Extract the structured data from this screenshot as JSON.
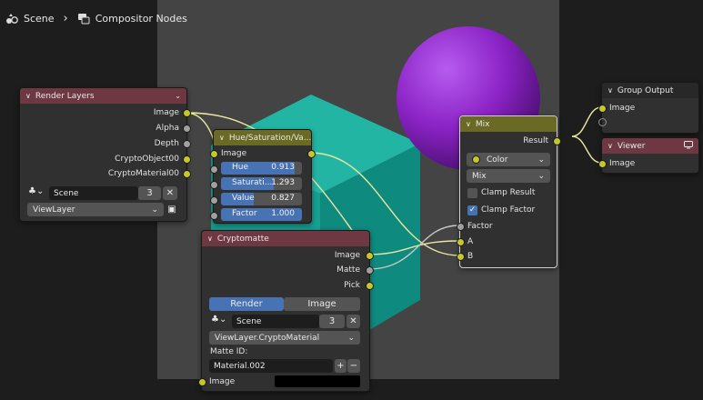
{
  "breadcrumb": {
    "scene": "Scene",
    "separator": "›",
    "tree": "Compositor Nodes",
    "scene_icon": "scene-icon",
    "tree_icon": "node-tree-icon"
  },
  "render_layers": {
    "title": "Render Layers",
    "outputs": [
      "Image",
      "Alpha",
      "Depth",
      "CryptoObject00",
      "CryptoMaterial00"
    ],
    "scene_name": "Scene",
    "scene_users": "3",
    "view_layer": "ViewLayer"
  },
  "hue_sat": {
    "title": "Hue/Saturation/Va...",
    "image_input": "Image",
    "fields": [
      {
        "label": "Hue",
        "value": "0.913",
        "fill": 0.913
      },
      {
        "label": "Saturati...",
        "value": "1.293",
        "fill": 0.65
      },
      {
        "label": "Value",
        "value": "0.827",
        "fill": 0.41
      },
      {
        "label": "Factor",
        "value": "1.000",
        "fill": 1.0
      }
    ]
  },
  "cryptomatte": {
    "title": "Cryptomatte",
    "outputs": [
      "Image",
      "Matte",
      "Pick"
    ],
    "tabs": [
      "Render",
      "Image"
    ],
    "scene_name": "Scene",
    "scene_users": "3",
    "layer": "ViewLayer.CryptoMaterial",
    "matte_id_label": "Matte ID:",
    "matte_id": "Material.002",
    "image_input": "Image",
    "add": "+",
    "remove": "−"
  },
  "mix": {
    "title": "Mix",
    "result": "Result",
    "mode": "Color",
    "blend": "Mix",
    "clamp_result": "Clamp Result",
    "clamp_result_checked": false,
    "clamp_factor": "Clamp Factor",
    "clamp_factor_checked": true,
    "inputs": [
      "Factor",
      "A",
      "B"
    ]
  },
  "group_output": {
    "title": "Group Output",
    "input": "Image"
  },
  "viewer": {
    "title": "Viewer",
    "input": "Image"
  },
  "colors": {
    "accent": "#4772b3",
    "teal": "#1aa394",
    "purple": "#8a22c4",
    "socket_color": "#c7c729",
    "socket_float": "#a0a0a0"
  }
}
